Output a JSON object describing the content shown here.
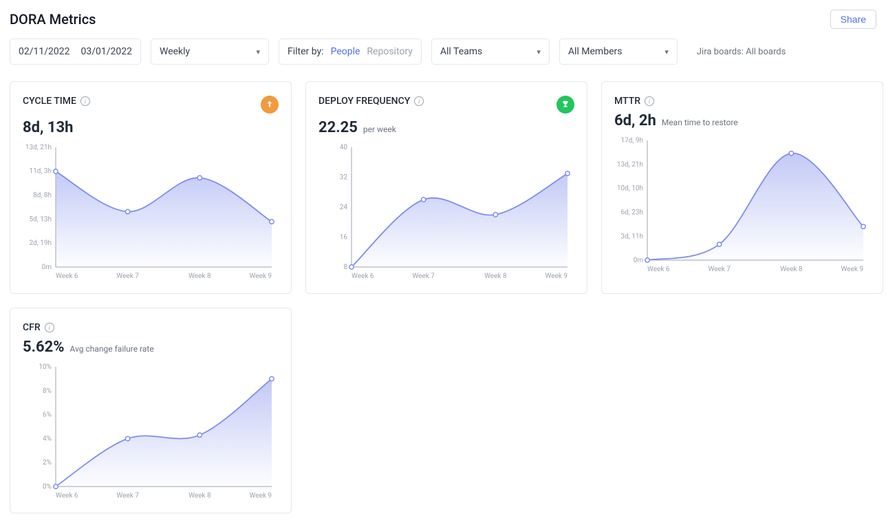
{
  "header": {
    "title": "DORA Metrics",
    "share": "Share"
  },
  "filters": {
    "date_start": "02/11/2022",
    "date_end": "03/01/2022",
    "granularity": "Weekly",
    "filter_label": "Filter by:",
    "filter_people": "People",
    "filter_repo": "Repository",
    "teams": "All Teams",
    "members": "All Members",
    "jira": "Jira boards: All boards"
  },
  "cards": {
    "cycle": {
      "title": "CYCLE TIME",
      "value": "8d, 13h",
      "sub": ""
    },
    "deploy": {
      "title": "DEPLOY FREQUENCY",
      "value": "22.25",
      "sub": "per week"
    },
    "mttr": {
      "title": "MTTR",
      "value": "6d, 2h",
      "sub": "Mean time to restore"
    },
    "cfr": {
      "title": "CFR",
      "value": "5.62%",
      "sub": "Avg change failure rate"
    }
  },
  "chart_data": [
    {
      "id": "cycle",
      "type": "line",
      "categories": [
        "Week 6",
        "Week 7",
        "Week 8",
        "Week 9"
      ],
      "values": [
        266,
        154,
        248,
        126
      ],
      "y_ticks": [
        0,
        67,
        133,
        200,
        267,
        333
      ],
      "y_tick_labels": [
        "0m",
        "2d, 19h",
        "5d, 13h",
        "8d, 8h",
        "11d, 3h",
        "13d, 21h"
      ],
      "ylim": [
        0,
        333
      ]
    },
    {
      "id": "deploy",
      "type": "line",
      "categories": [
        "Week 6",
        "Week 7",
        "Week 8",
        "Week 9"
      ],
      "values": [
        8,
        26,
        22,
        33
      ],
      "y_ticks": [
        8,
        16,
        24,
        32,
        40
      ],
      "y_tick_labels": [
        "8",
        "16",
        "24",
        "32",
        "40"
      ],
      "ylim": [
        8,
        40
      ]
    },
    {
      "id": "mttr",
      "type": "line",
      "categories": [
        "Week 6",
        "Week 7",
        "Week 8",
        "Week 9"
      ],
      "values": [
        0,
        55,
        372,
        117
      ],
      "y_ticks": [
        0,
        83,
        166,
        250,
        333,
        417
      ],
      "y_tick_labels": [
        "0m",
        "3d, 11h",
        "6d, 23h",
        "10d, 10h",
        "13d, 21h",
        "17d, 9h"
      ],
      "ylim": [
        0,
        417
      ]
    },
    {
      "id": "cfr",
      "type": "line",
      "categories": [
        "Week 6",
        "Week 7",
        "Week 8",
        "Week 9"
      ],
      "values": [
        0,
        4,
        4.3,
        9
      ],
      "y_ticks": [
        0,
        2,
        4,
        6,
        8,
        10
      ],
      "y_tick_labels": [
        "0%",
        "2%",
        "4%",
        "6%",
        "8%",
        "10%"
      ],
      "ylim": [
        0,
        10
      ]
    }
  ]
}
